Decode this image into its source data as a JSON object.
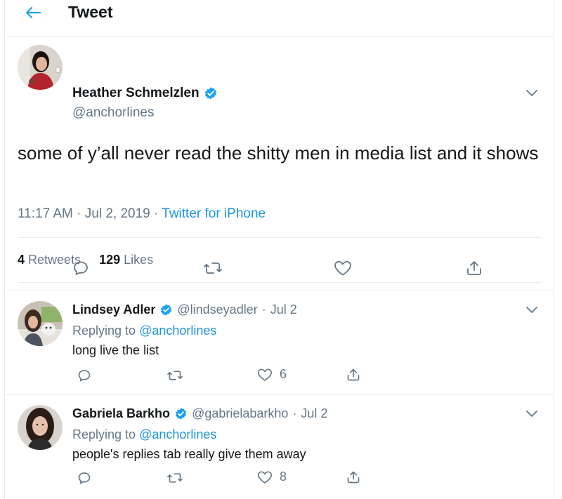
{
  "header": {
    "title": "Tweet"
  },
  "main_tweet": {
    "author_name": "Heather Schmelzlen",
    "author_handle": "@anchorlines",
    "text": "some of y’all never read the shitty men in media list and it shows",
    "time": "11:17 AM",
    "date": "Jul 2, 2019",
    "separator": "·",
    "app": "Twitter for iPhone",
    "retweets_count": "4",
    "retweets_label": "Retweets",
    "likes_count": "129",
    "likes_label": "Likes"
  },
  "replies": [
    {
      "author_name": "Lindsey Adler",
      "author_handle": "@lindseyadler",
      "date": "Jul 2",
      "replying_prefix": "Replying to",
      "replying_to": "@anchorlines",
      "text": "long live the list",
      "like_count": "6"
    },
    {
      "author_name": "Gabriela Barkho",
      "author_handle": "@gabrielabarkho",
      "date": "Jul 2",
      "replying_prefix": "Replying to",
      "replying_to": "@anchorlines",
      "text": "people's replies tab really give them away",
      "like_count": "8"
    }
  ],
  "colors": {
    "accent": "#1da1f2",
    "link": "#1b95e0",
    "muted": "#657786",
    "divider": "#e6ecf0"
  }
}
